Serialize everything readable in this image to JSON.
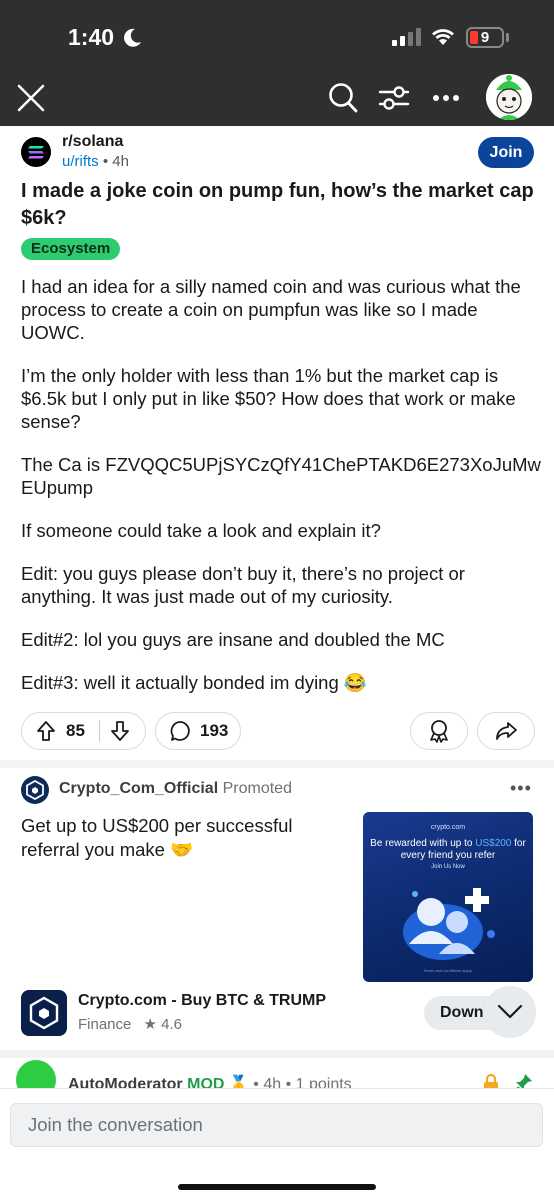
{
  "status_bar": {
    "time": "1:40",
    "battery": "9"
  },
  "post": {
    "subreddit": "r/solana",
    "author": "u/rifts",
    "separator": "•",
    "age": "4h",
    "join_label": "Join",
    "title": "I made a joke coin on pump fun, how’s the market cap $6k?",
    "flair": "Ecosystem",
    "body": [
      "I had an idea for a silly named coin and was curious what the process to create a coin on pumpfun was like so I made UOWC.",
      "I’m the only holder with less than 1% but the market cap is $6.5k but I only put in like $50? How does that work or make sense?",
      "The Ca is FZVQQC5UPjSYCzQfY41ChePTAKD6E273XoJuMwEUpump",
      "If someone could take a look and explain it?",
      "Edit: you guys please don’t buy it, there’s no project or anything. It was just made out of my curiosity.",
      "Edit#2: lol you guys are insane and doubled the MC",
      "Edit#3: well it actually bonded im dying 😂"
    ],
    "upvotes": "85",
    "comments": "193"
  },
  "ad": {
    "advertiser": "Crypto_Com_Official",
    "promoted_label": "Promoted",
    "text": "Get up to US$200 per successful referral you make 🤝",
    "image": {
      "brand": "crypto.com",
      "headline_a": "Be rewarded with up to ",
      "headline_highlight": "US$200",
      "headline_b": " for every friend you refer",
      "cta": "Join Us Now",
      "fine_print": "Terms and conditions apply.",
      "highlight_color": "#5fb0ff"
    },
    "app_name": "Crypto.com - Buy BTC & TRUMP",
    "app_category": "Finance",
    "app_rating": "4.6",
    "download_label": "Download"
  },
  "comment_preview": {
    "author": "AutoModerator",
    "badge": "MOD",
    "emoji": "🥇",
    "age": "4h",
    "points": "1 points"
  },
  "composer": {
    "placeholder": "Join the conversation"
  },
  "colors": {
    "join_bg": "#0a449b",
    "flair_bg": "#2ecc71",
    "link": "#0079d3",
    "topbar": "#2f2f2f"
  }
}
